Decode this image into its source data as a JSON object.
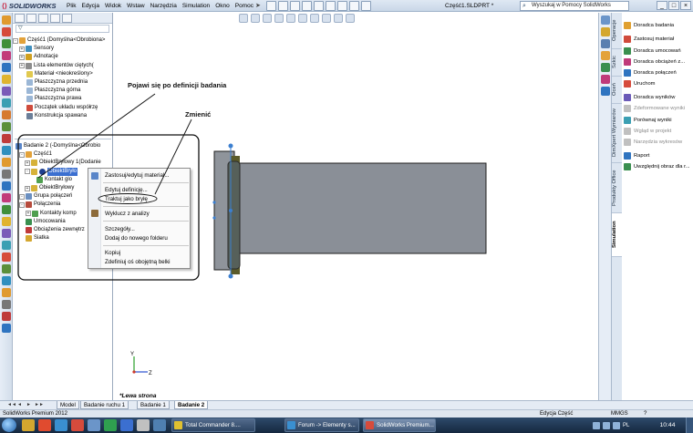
{
  "titlebar": {
    "app_name": "SOLIDWORKS",
    "menus": [
      "Plik",
      "Edycja",
      "Widok",
      "Wstaw",
      "Narzędzia",
      "Simulation",
      "Okno",
      "Pomoc"
    ],
    "document_title": "Część1.SLDPRT *",
    "search_placeholder": "Wyszukaj w Pomocy SolidWorks",
    "window_controls": [
      "_",
      "□",
      "×"
    ]
  },
  "feature_tree": {
    "filter_symbol": "▽",
    "items": [
      {
        "label": "Część1  (Domyślna<Obrobiona>"
      },
      {
        "label": "Sensory"
      },
      {
        "label": "Adnotacje"
      },
      {
        "label": "Lista elementów ciętych("
      },
      {
        "label": "Materiał <nieokreślony>"
      },
      {
        "label": "Płaszczyzna przednia"
      },
      {
        "label": "Płaszczyzna górna"
      },
      {
        "label": "Płaszczyzna prawa"
      },
      {
        "label": "Początek układu współrzę"
      },
      {
        "label": "Konstrukcja spawana"
      }
    ]
  },
  "sim_tree": {
    "items": [
      {
        "label": "Badanie 2 (-Domyślna<Obrobio"
      },
      {
        "label": "Część1"
      },
      {
        "label": "ObiektBryłowy 1(Dodanie"
      },
      {
        "label": "ObiektBryło"
      },
      {
        "label": "Kontakt glo"
      },
      {
        "label": "ObiektBryłowy"
      },
      {
        "label": "Grupa połączeń"
      },
      {
        "label": "Połączenia"
      },
      {
        "label": "Kontakty komp"
      },
      {
        "label": "Umocowania"
      },
      {
        "label": "Obciążenia zewnętrz"
      },
      {
        "label": "Siatka"
      }
    ]
  },
  "context_menu": {
    "items": [
      "Zastosuj/edytuj materiał...",
      "Edytuj definicję...",
      "Traktuj jako bryłę",
      "Wyklucz z analizy",
      "Szczegóły...",
      "Dodaj do nowego folderu",
      "Kopiuj",
      "Zdefiniuj oś obojętną belki"
    ]
  },
  "annotations": {
    "note1": "Pojawi się po definicji badania",
    "note2": "Zmienić"
  },
  "graphics": {
    "view_label": "*Lewa strona",
    "axis_y": "Y",
    "axis_z": "Z"
  },
  "task_pane": {
    "vertical_tabs": [
      "Operacje",
      "Szkic",
      "Oceń",
      "DimXpert Wymiarów",
      "Produkty Office",
      "Simulation"
    ],
    "items": [
      {
        "label": "Doradca badania",
        "disabled": false
      },
      {
        "label": "Zastosuj materiał",
        "disabled": false
      },
      {
        "label": "Doradca umocowań",
        "disabled": false
      },
      {
        "label": "Doradca obciążeń z...",
        "disabled": false
      },
      {
        "label": "Doradca połączeń",
        "disabled": false
      },
      {
        "label": "Uruchom",
        "disabled": false
      },
      {
        "label": "Doradca wyników",
        "disabled": false
      },
      {
        "label": "Zdeformowane wyniki",
        "disabled": true
      },
      {
        "label": "Porównaj wyniki",
        "disabled": false
      },
      {
        "label": "Wgląd w projekt",
        "disabled": true
      },
      {
        "label": "Narzędzia wykresów",
        "disabled": true
      },
      {
        "label": "Raport",
        "disabled": false
      },
      {
        "label": "Uwzględnij obraz dla r...",
        "disabled": false
      }
    ]
  },
  "doc_tabs": {
    "nav": [
      "◄◄",
      "◄",
      "►",
      "►►"
    ],
    "tabs": [
      "Model",
      "Badanie ruchu 1",
      "Badanie 1",
      "Badanie 2"
    ],
    "active": "Badanie 2"
  },
  "status": {
    "left": "SolidWorks Premium 2012",
    "center": "Edycja Część",
    "units": "MMGS",
    "help": "?"
  },
  "taskbar": {
    "buttons": [
      "Total Commander 8....",
      "Forum -> Elementy s...",
      "SolidWorks Premium..."
    ],
    "language": "PL",
    "clock": "10:44"
  },
  "colors": {
    "accent": "#3b6fd0",
    "part_face": "#8a8f97",
    "part_edge": "#1e1e1e",
    "highlight_ring": "#5b5b2a"
  }
}
